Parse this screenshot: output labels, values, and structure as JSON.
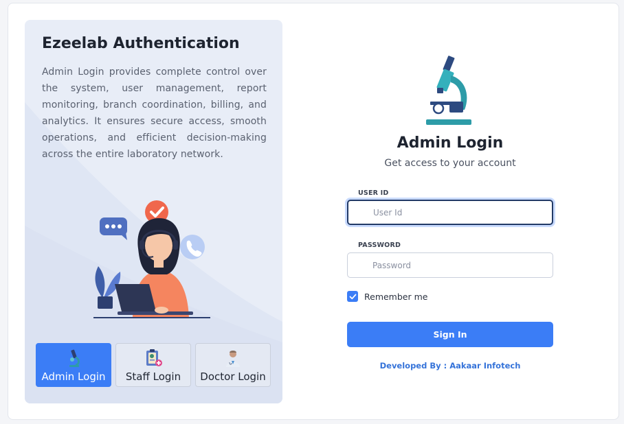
{
  "left_panel": {
    "title": "Ezeelab Authentication",
    "description": "Admin Login provides complete control over the system, user management, report monitoring, branch coordination, billing, and analytics. It ensures secure access, smooth operations, and efficient decision-making across the entire laboratory network.",
    "illustration": "support-agent-illustration"
  },
  "role_tabs": [
    {
      "label": "Admin Login",
      "icon": "microscope-icon",
      "active": true
    },
    {
      "label": "Staff Login",
      "icon": "clipboard-icon",
      "active": false
    },
    {
      "label": "Doctor Login",
      "icon": "doctor-icon",
      "active": false
    }
  ],
  "login": {
    "logo_icon": "microscope-icon",
    "title": "Admin Login",
    "subtitle": "Get access to your account",
    "user_id": {
      "label": "USER ID",
      "placeholder": "User Id",
      "value": ""
    },
    "password": {
      "label": "PASSWORD",
      "placeholder": "Password",
      "value": ""
    },
    "remember_me": {
      "label": "Remember me",
      "checked": true
    },
    "signin_label": "Sign In",
    "developed_by": "Developed By : Aakaar Infotech"
  },
  "colors": {
    "accent": "#3b7df6",
    "panel_bg": "#e8edf7",
    "link": "#3573d9"
  }
}
